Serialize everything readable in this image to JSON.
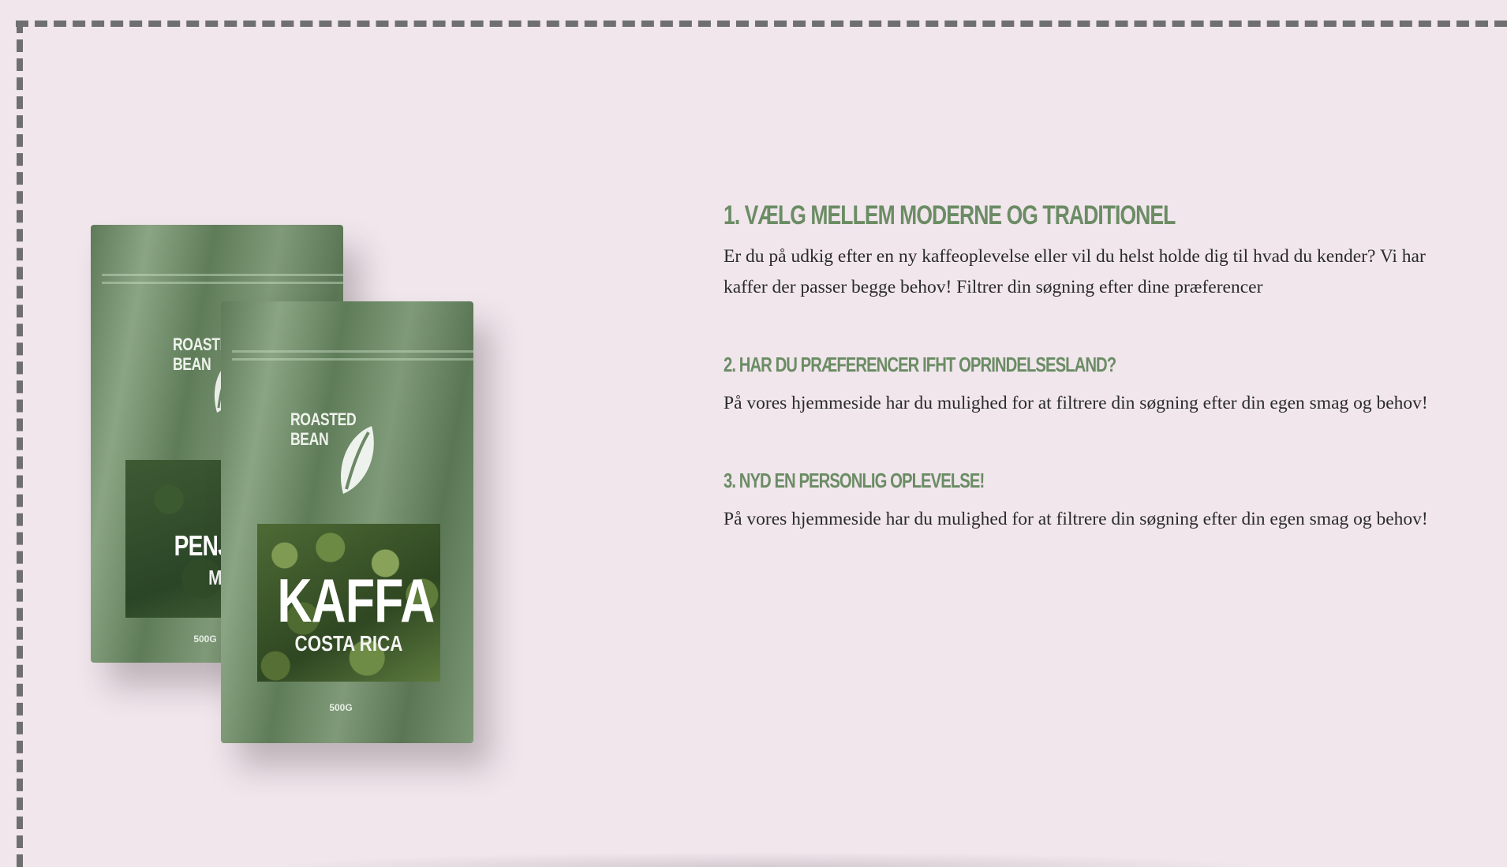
{
  "product_image": {
    "alt": "Roasted Bean coffee bags",
    "back_bag": {
      "brand_line1": "ROASTE",
      "brand_line2": "BEAN",
      "label_title": "PENJA COL",
      "label_sub": "MEXIC",
      "weight": "500G"
    },
    "front_bag": {
      "brand_line1": "ROASTED",
      "brand_line2": "BEAN",
      "label_title": "KAFFA",
      "label_sub": "COSTA RICA",
      "weight": "500G"
    }
  },
  "steps": [
    {
      "title": "1. VÆLG MELLEM MODERNE OG TRADITIONEL",
      "text": "Er du på udkig efter en ny kaffeoplevelse eller vil du helst holde dig til hvad du kender? Vi har kaffer der passer begge behov! Filtrer din søgning efter dine præferencer"
    },
    {
      "title": "2. HAR DU PRÆFERENCER IFHT OPRINDELSESLAND?",
      "text": "På vores hjemmeside har du mulighed for at filtrere din søgning efter din egen smag og behov!"
    },
    {
      "title": "3. NYD EN PERSONLIG OPLEVELSE!",
      "text": "På vores hjemmeside har du mulighed for at filtrere din søgning efter din egen smag og behov!"
    }
  ],
  "colors": {
    "background": "#f0e6ec",
    "heading": "#6b8c64",
    "body_text": "#2b2b2b",
    "border": "#6f6f6f"
  }
}
